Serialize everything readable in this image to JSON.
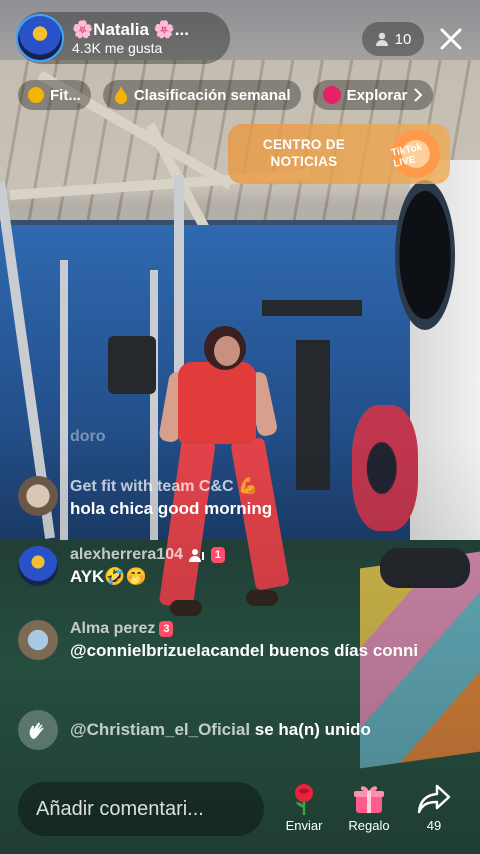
{
  "host": {
    "name": "🌸Natalia 🌸...",
    "likes": "4.3K me gusta"
  },
  "viewers": {
    "count": "10"
  },
  "chips": [
    {
      "label": "Fit...",
      "icon": "coin-icon",
      "color": "#f5b400"
    },
    {
      "label": "Clasificación semanal",
      "icon": "flame-icon",
      "color": "#f5b400"
    },
    {
      "label": "Explorar",
      "icon": "explore-dot-icon",
      "color": "#e8206a"
    }
  ],
  "banner": {
    "label": "CENTRO DE NOTICIAS",
    "badge": "TikTok LIVE"
  },
  "chat": [
    {
      "user": "doro",
      "text": "",
      "badge": "",
      "avatar": false
    },
    {
      "user": "Get fit with team C&C 💪",
      "text": "hola chica good morning",
      "badge": "",
      "avatar": true
    },
    {
      "user": "alexherrera104",
      "text": "AYK🤣🤭",
      "badge": "1",
      "avatar": true
    },
    {
      "user": "Alma perez",
      "text": "@connielbrizuelacandel buenos días conni",
      "badge": "3",
      "avatar": true
    }
  ],
  "join": {
    "user": "@Christiam_el_Oficial",
    "text": "se ha(n) unido"
  },
  "bottom": {
    "placeholder": "Añadir comentari...",
    "send_label": "Enviar",
    "gift_label": "Regalo",
    "share_count": "49"
  },
  "colors": {
    "accent": "#fe2c55",
    "banner": "#eb963c"
  }
}
